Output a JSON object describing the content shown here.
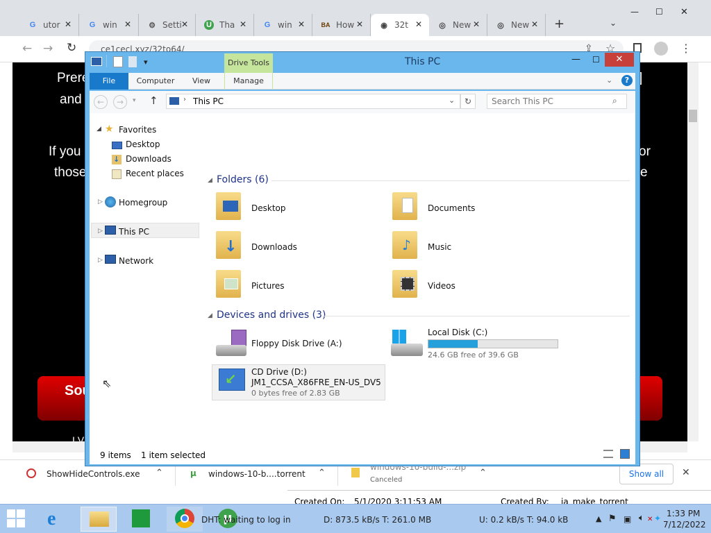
{
  "chrome": {
    "tabs": [
      {
        "favicon": "G",
        "label": "utor"
      },
      {
        "favicon": "G",
        "label": "win"
      },
      {
        "favicon": "gear",
        "label": "Setti"
      },
      {
        "favicon": "U",
        "label": "Tha"
      },
      {
        "favicon": "G",
        "label": "win"
      },
      {
        "favicon": "BA",
        "label": "How"
      },
      {
        "favicon": "globe",
        "label": "32t"
      },
      {
        "favicon": "chrome",
        "label": "New"
      },
      {
        "favicon": "chrome",
        "label": "New"
      }
    ],
    "new_tab": "+",
    "url": "ce1cecl.xyz/32to64/",
    "colors": {
      "tabstrip": "#dee1e6",
      "active_tab": "#ffffff"
    }
  },
  "web": {
    "lines": [
      "Prere",
      "and",
      "If you",
      "those",
      "or",
      "e",
      "]"
    ],
    "button_text": "Sou",
    "bottom_text": "I V"
  },
  "downloads": {
    "items": [
      {
        "name": "ShowHideControls.exe",
        "status": ""
      },
      {
        "name": "windows-10-b....torrent",
        "status": ""
      },
      {
        "name": "windows-10-build-...zip",
        "status": "Canceled"
      }
    ],
    "show_all": "Show all"
  },
  "properties_strip": {
    "created_on_label": "Created On:",
    "created_on": "5/1/2020 3:11:53 AM",
    "created_by_label": "Created By:",
    "created_by": "ia_make_torrent"
  },
  "explorer": {
    "title": "This PC",
    "drive_tools": "Drive Tools",
    "ribbon_tabs": [
      "File",
      "Computer",
      "View",
      "Manage"
    ],
    "address": "This PC",
    "search_placeholder": "Search This PC",
    "nav": {
      "favorites": "Favorites",
      "fav_items": [
        "Desktop",
        "Downloads",
        "Recent places"
      ],
      "homegroup": "Homegroup",
      "this_pc": "This PC",
      "network": "Network"
    },
    "folders_header": "Folders (6)",
    "folders": [
      "Desktop",
      "Documents",
      "Downloads",
      "Music",
      "Pictures",
      "Videos"
    ],
    "devices_header": "Devices and drives (3)",
    "drives": [
      {
        "name": "Floppy Disk Drive (A:)"
      },
      {
        "name": "Local Disk (C:)",
        "free": "24.6 GB free of 39.6 GB",
        "used_fraction": 0.38
      },
      {
        "name": "CD Drive (D:)",
        "label": "JM1_CCSA_X86FRE_EN-US_DV5",
        "free": "0 bytes free of 2.83 GB"
      }
    ],
    "status_items": "9 items",
    "status_selected": "1 item selected",
    "colors": {
      "frame": "#69b7ec",
      "close": "#c7403a",
      "file_tab": "#1979ca",
      "drive_tools": "#c6e59c"
    }
  },
  "taskbar": {
    "dht_text": "DHT: waiting to log in",
    "download": "D: 873.5 kB/s T: 261.0 MB",
    "upload": "U: 0.2 kB/s T: 94.0 kB",
    "time": "1:33 PM",
    "date": "7/12/2022"
  }
}
